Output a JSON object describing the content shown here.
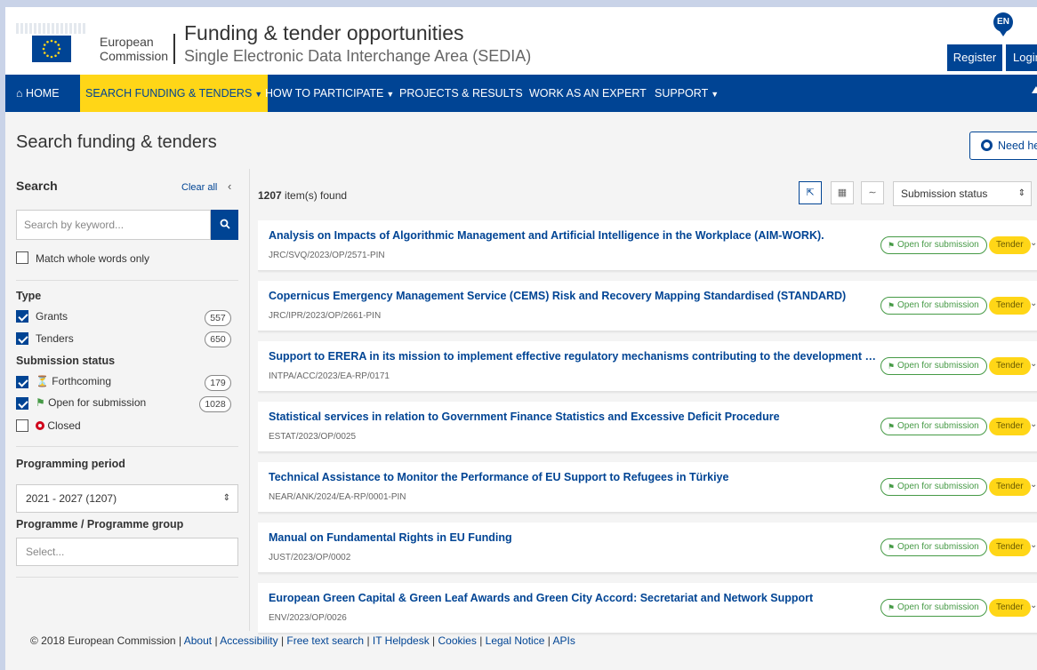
{
  "header": {
    "brand_line1": "European",
    "brand_line2": "Commission",
    "title": "Funding & tender opportunities",
    "subtitle": "Single Electronic Data Interchange Area (SEDIA)",
    "lang": "EN",
    "register": "Register",
    "login": "Login"
  },
  "nav": {
    "home": "HOME",
    "search": "SEARCH FUNDING & TENDERS",
    "participate": "HOW TO PARTICIPATE",
    "projects": "PROJECTS & RESULTS",
    "expert": "WORK AS AN EXPERT",
    "support": "SUPPORT"
  },
  "page": {
    "title": "Search funding & tenders",
    "need_help": "Need help?"
  },
  "sidebar": {
    "search_label": "Search",
    "clear_all": "Clear all",
    "keyword_placeholder": "Search by keyword...",
    "match_whole": "Match whole words only",
    "type_heading": "Type",
    "type_items": [
      {
        "label": "Grants",
        "count": "557"
      },
      {
        "label": "Tenders",
        "count": "650"
      }
    ],
    "status_heading": "Submission status",
    "status_items": [
      {
        "label": "Forthcoming",
        "count": "179"
      },
      {
        "label": "Open for submission",
        "count": "1028"
      },
      {
        "label": "Closed",
        "count": ""
      }
    ],
    "period_heading": "Programming period",
    "period_value": "2021 - 2027 (1207)",
    "programme_heading": "Programme / Programme group",
    "programme_placeholder": "Select..."
  },
  "results": {
    "count": "1207",
    "count_suffix": "item(s) found",
    "status_select": "Submission status",
    "items": [
      {
        "title": "Analysis on Impacts of Algorithmic Management and Artificial Intelligence in the Workplace (AIM-WORK).",
        "ref": "JRC/SVQ/2023/OP/2571-PIN",
        "status": "Open for submission",
        "type": "Tender"
      },
      {
        "title": "Copernicus Emergency Management Service (CEMS) Risk and Recovery Mapping Standardised (STANDARD)",
        "ref": "JRC/IPR/2023/OP/2661-PIN",
        "status": "Open for submission",
        "type": "Tender"
      },
      {
        "title": "Support to ERERA in its mission to implement effective regulatory mechanisms contributing to the development of a regional ele...",
        "ref": "INTPA/ACC/2023/EA-RP/0171",
        "status": "Open for submission",
        "type": "Tender"
      },
      {
        "title": "Statistical services in relation to Government Finance Statistics and Excessive Deficit Procedure",
        "ref": "ESTAT/2023/OP/0025",
        "status": "Open for submission",
        "type": "Tender"
      },
      {
        "title": "Technical Assistance to Monitor the Performance of EU Support to Refugees in Türkiye",
        "ref": "NEAR/ANK/2024/EA-RP/0001-PIN",
        "status": "Open for submission",
        "type": "Tender"
      },
      {
        "title": "Manual on Fundamental Rights in EU Funding",
        "ref": "JUST/2023/OP/0002",
        "status": "Open for submission",
        "type": "Tender"
      },
      {
        "title": "European Green Capital & Green Leaf Awards and Green City Accord: Secretariat and Network Support",
        "ref": "ENV/2023/OP/0026",
        "status": "Open for submission",
        "type": "Tender"
      }
    ]
  },
  "footer": {
    "copyright": "© 2018 European Commission",
    "links": [
      "About",
      "Accessibility",
      "Free text search",
      "IT Helpdesk",
      "Cookies",
      "Legal Notice",
      "APIs"
    ]
  }
}
